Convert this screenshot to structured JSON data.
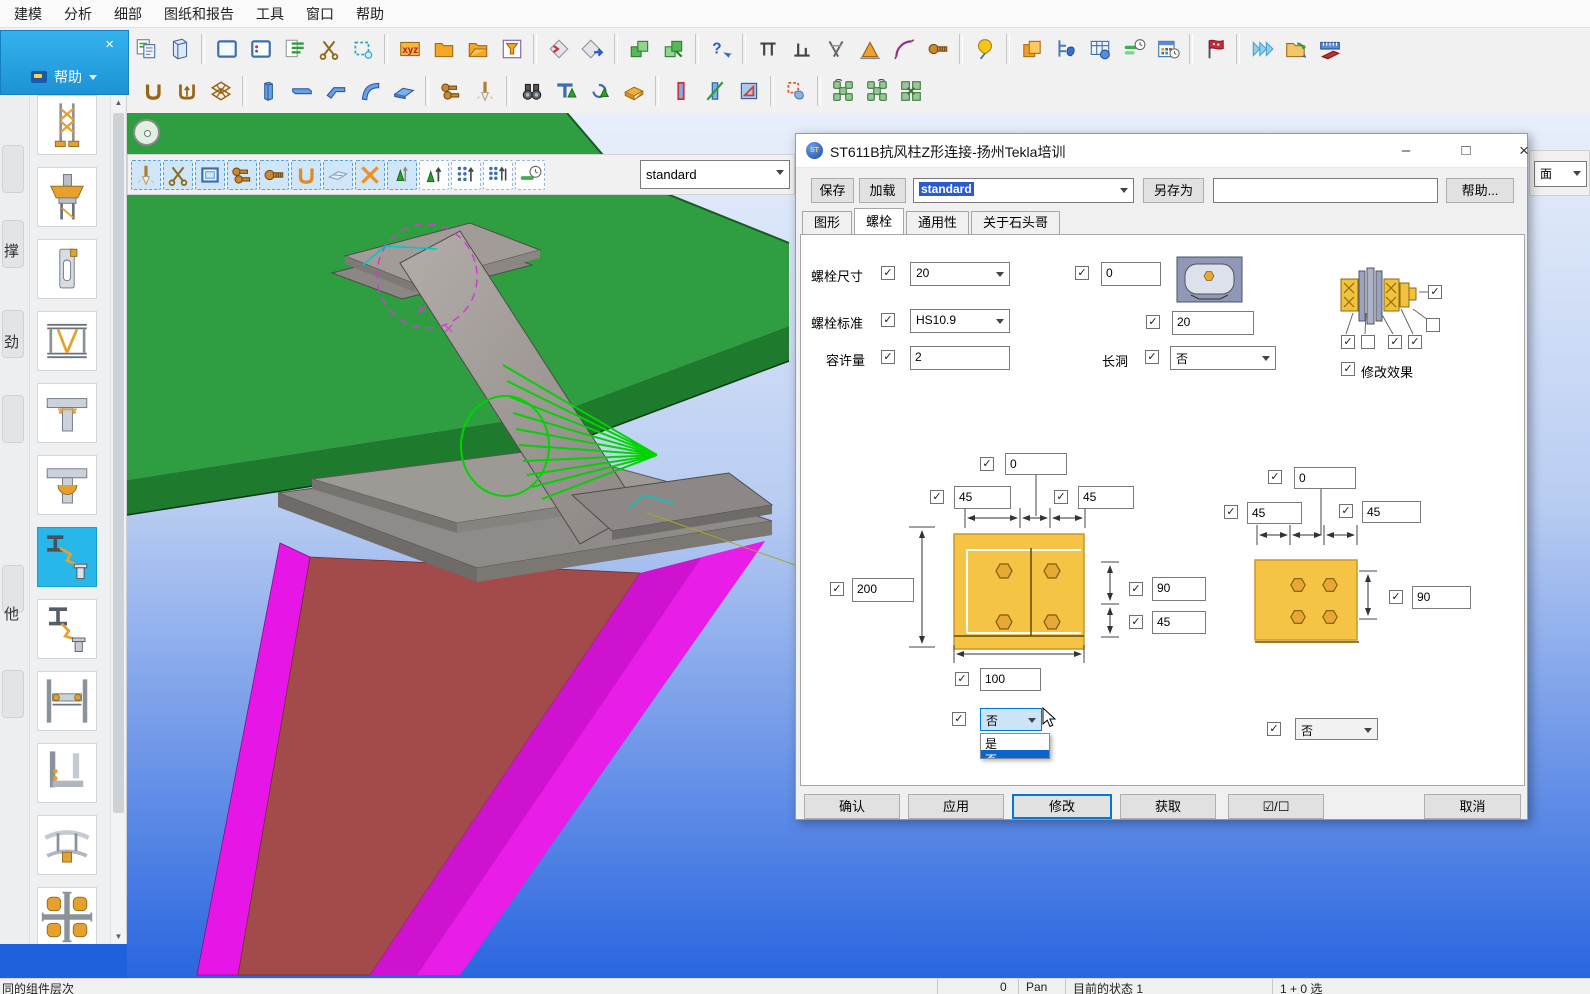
{
  "window": {
    "menu_items": [
      "建模",
      "分析",
      "细部",
      "图纸和报告",
      "工具",
      "窗口",
      "帮助"
    ]
  },
  "help_popup": {
    "close": "×",
    "label": "帮助"
  },
  "toolbars": {
    "row1": [
      {
        "n": "copy-report",
        "k": "pagecopy"
      },
      {
        "n": "model-view",
        "k": "door3d"
      },
      {
        "k": "sep"
      },
      {
        "n": "new-window",
        "k": "winsq"
      },
      {
        "n": "window-layout",
        "k": "winsq2"
      },
      {
        "n": "report-list",
        "k": "listpage"
      },
      {
        "n": "cut",
        "k": "scissors"
      },
      {
        "n": "area-select",
        "k": "lassosel"
      },
      {
        "k": "sep"
      },
      {
        "n": "coordinates-xyz",
        "k": "xyz"
      },
      {
        "n": "open-folder",
        "k": "folder"
      },
      {
        "n": "save-folder",
        "k": "folder2"
      },
      {
        "n": "view-filter",
        "k": "funnel"
      },
      {
        "k": "sep"
      },
      {
        "n": "prev-object",
        "k": "diamondR"
      },
      {
        "n": "next-object",
        "k": "diamondB"
      },
      {
        "k": "sep"
      },
      {
        "n": "copy-object",
        "k": "cubeg"
      },
      {
        "n": "move-object",
        "k": "cubeg2"
      },
      {
        "k": "sep"
      },
      {
        "n": "inquire",
        "k": "helppoint"
      },
      {
        "k": "sep"
      },
      {
        "n": "fence-top",
        "k": "fence1"
      },
      {
        "n": "fence-bottom",
        "k": "fence2"
      },
      {
        "n": "measure-angle",
        "k": "caliper"
      },
      {
        "n": "measure-area",
        "k": "triOrange"
      },
      {
        "n": "measure-arc",
        "k": "arcPurple"
      },
      {
        "n": "measure-bolt",
        "k": "boltB"
      },
      {
        "k": "sep"
      },
      {
        "n": "pick-point",
        "k": "pinY"
      },
      {
        "k": "sep"
      },
      {
        "n": "copy-parts",
        "k": "copyO"
      },
      {
        "n": "object-tree",
        "k": "treeB"
      },
      {
        "n": "report-table",
        "k": "tableB"
      },
      {
        "n": "task-clock",
        "k": "clockG"
      },
      {
        "n": "schedule",
        "k": "calendar"
      },
      {
        "k": "sep"
      },
      {
        "n": "project-flag",
        "k": "flagR"
      },
      {
        "k": "sep"
      },
      {
        "n": "fast-forward",
        "k": "chev"
      },
      {
        "n": "refresh-folder",
        "k": "folderArr"
      },
      {
        "n": "measure-ruler",
        "k": "rulerR"
      }
    ],
    "row2": [
      {
        "n": "channel-u",
        "k": "uB"
      },
      {
        "n": "channel-u2",
        "k": "uB2"
      },
      {
        "n": "grid-create",
        "k": "gridB"
      },
      {
        "k": "sep"
      },
      {
        "n": "column-create",
        "k": "colB"
      },
      {
        "n": "beam-create",
        "k": "beamB"
      },
      {
        "n": "polybeam-create",
        "k": "polyB"
      },
      {
        "n": "curved-beam",
        "k": "curveB"
      },
      {
        "n": "plate-create",
        "k": "plateB"
      },
      {
        "k": "sep"
      },
      {
        "n": "bolt-create",
        "k": "boltPair"
      },
      {
        "n": "weld-create",
        "k": "weldTorch"
      },
      {
        "k": "sep"
      },
      {
        "n": "find-objects",
        "k": "binoc"
      },
      {
        "n": "column-orthogonal",
        "k": "tG"
      },
      {
        "n": "twin-profile",
        "k": "spiralG"
      },
      {
        "n": "pad-footing",
        "k": "padO"
      },
      {
        "k": "sep"
      },
      {
        "n": "member-end",
        "k": "membRed"
      },
      {
        "n": "member-diagonal",
        "k": "membGreen"
      },
      {
        "n": "member-triangle",
        "k": "membTri"
      },
      {
        "k": "sep"
      },
      {
        "n": "select-lasso",
        "k": "lassoRed"
      },
      {
        "k": "sep"
      },
      {
        "n": "auto-connect-1",
        "k": "clusterG"
      },
      {
        "n": "auto-connect-2",
        "k": "clusterG2"
      },
      {
        "n": "auto-connect-3",
        "k": "clusterX"
      }
    ],
    "row3": [
      {
        "n": "select-welds",
        "k": "weldTorch",
        "t": true
      },
      {
        "n": "select-cuts",
        "k": "scissors",
        "t": true
      },
      {
        "n": "select-views",
        "k": "sq3",
        "t": true
      },
      {
        "n": "select-bolt-groups",
        "k": "boltPair",
        "t": true
      },
      {
        "n": "select-single-bolts",
        "k": "boltB",
        "t": true
      },
      {
        "n": "select-components",
        "k": "uO",
        "t": true
      },
      {
        "n": "select-planes",
        "k": "planeIc",
        "t": true
      },
      {
        "n": "select-auxiliary",
        "k": "crossO",
        "t": true
      },
      {
        "n": "select-points",
        "k": "coneG2",
        "t": true
      },
      {
        "n": "select-grids",
        "k": "coneArrow",
        "t": false
      },
      {
        "n": "select-grid-lines",
        "k": "dotGrid",
        "t": false
      },
      {
        "n": "select-rebar",
        "k": "dotGrid2",
        "t": false
      },
      {
        "n": "select-loads",
        "k": "clockSm",
        "t": false
      }
    ],
    "row3_profile": "standard",
    "face_combo": "面"
  },
  "sidebar": {
    "labels": [
      "撑",
      "劲",
      "他"
    ],
    "selected_index": 6,
    "thumb_count": 12
  },
  "dialog": {
    "title": "ST611B抗风柱Z形连接-扬州Tekla培训",
    "window_controls": {
      "minimize": "–",
      "maximize": "□",
      "close": "×"
    },
    "toolbar": {
      "save": "保存",
      "load": "加载",
      "profile": "standard",
      "save_as": "另存为",
      "save_as_value": "",
      "help": "帮助..."
    },
    "tabs": [
      "图形",
      "螺栓",
      "通用性",
      "关于石头哥"
    ],
    "active_tab_index": 1,
    "fields": {
      "bolt_size_label": "螺栓尺寸",
      "bolt_size": "20",
      "bolt_standard_label": "螺栓标准",
      "bolt_standard": "HS10.9",
      "tolerance_label": "容许量",
      "tolerance": "2",
      "hole_offset": "0",
      "hole_extra": "20",
      "slotted_label": "长洞",
      "slotted": "否",
      "modify_effect_label": "修改效果",
      "assembly_checks_right": [
        true,
        false
      ],
      "assembly_checks_bottom": [
        true,
        false,
        true,
        true
      ]
    },
    "left_diagram": {
      "offset": "0",
      "left": "45",
      "right": "45",
      "height": "200",
      "spacing": "90",
      "bottom": "45",
      "width": "100",
      "stagger": "否",
      "dropdown_items": [
        "是",
        "否"
      ],
      "dropdown_selected_index": 1
    },
    "right_diagram": {
      "offset": "0",
      "left": "45",
      "right": "45",
      "spacing": "90",
      "stagger": "否"
    },
    "buttons": [
      "确认",
      "应用",
      "修改",
      "获取",
      "☑/☐",
      "取消"
    ],
    "focused_button_index": 2
  },
  "status_bar": {
    "left": "同的组件层次",
    "count": "0",
    "mode": "Pan",
    "state": "目前的状态 1",
    "selection": "1 + 0 选"
  },
  "colors": {
    "selection_blue": "#2a5ad0",
    "plate_yellow": "#f6c445",
    "highlight_cyan": "#29b6e8",
    "viewport_bottom": "#2a66e0",
    "beam_green": "#2f9e41",
    "column_magenta": "#e616e6",
    "column_web_red": "#a34a4a"
  }
}
